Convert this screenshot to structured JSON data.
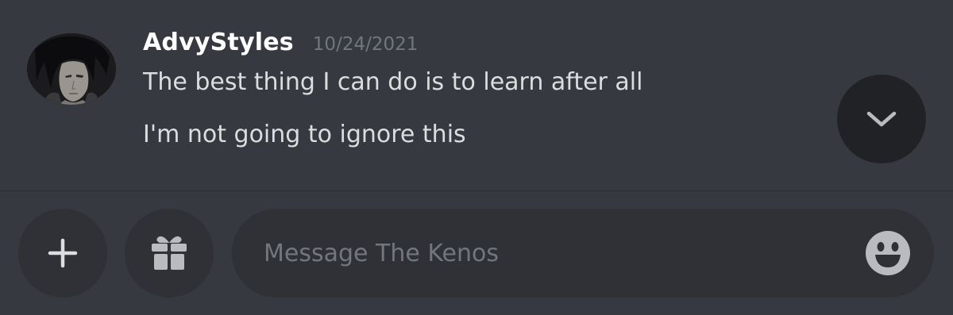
{
  "message": {
    "author": "AdvyStyles",
    "timestamp": "10/24/2021",
    "lines": [
      "The best thing I can do is to learn after all",
      "I'm not going to ignore this"
    ]
  },
  "jump_button": {
    "icon": "chevron-down-icon"
  },
  "composer": {
    "placeholder": "Message The Kenos",
    "buttons": [
      {
        "icon": "plus-icon"
      },
      {
        "icon": "gift-icon"
      },
      {
        "icon": "emoji-smile-icon"
      }
    ]
  },
  "colors": {
    "background": "#36393f",
    "input_background": "#2f3136",
    "jump_button_background": "#202225",
    "username": "#ffffff",
    "message_text": "#dcddde",
    "muted": "#72767d",
    "icon": "#b9bbbe"
  }
}
